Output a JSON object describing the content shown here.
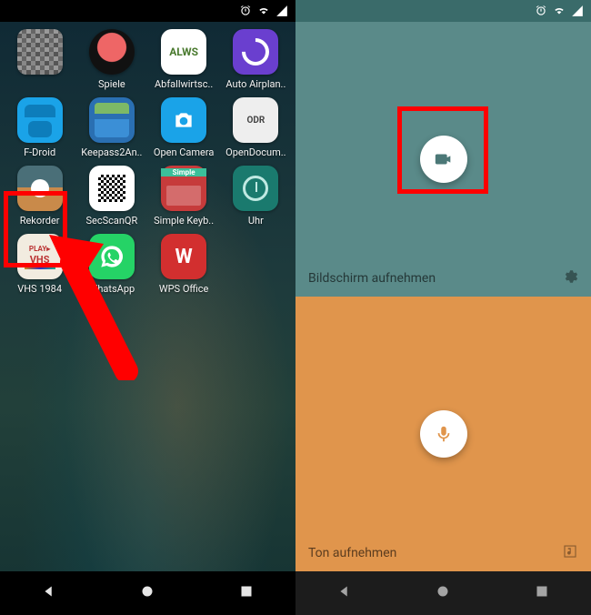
{
  "status": {
    "icons": [
      "alarm",
      "wifi",
      "signal"
    ]
  },
  "drawer": {
    "apps": [
      {
        "id": "pixelated",
        "label": ""
      },
      {
        "id": "spiele",
        "label": "Spiele"
      },
      {
        "id": "alws",
        "label": "Abfallwirtsc..",
        "text": "ALWS"
      },
      {
        "id": "auto",
        "label": "Auto Airplan.."
      },
      {
        "id": "fdroid",
        "label": "F-Droid"
      },
      {
        "id": "keepass",
        "label": "Keepass2An.."
      },
      {
        "id": "opencam",
        "label": "Open Camera"
      },
      {
        "id": "odr",
        "label": "OpenDocum..",
        "text": "ODR"
      },
      {
        "id": "rekorder",
        "label": "Rekorder"
      },
      {
        "id": "secscan",
        "label": "SecScanQR"
      },
      {
        "id": "keyb",
        "label": "Simple Keyb.."
      },
      {
        "id": "uhr",
        "label": "Uhr"
      },
      {
        "id": "vhs",
        "label": "VHS 1984",
        "text": "PLAY▸"
      },
      {
        "id": "whatsapp",
        "label": "WhatsApp"
      },
      {
        "id": "wps",
        "label": "WPS Office",
        "text": "W"
      }
    ]
  },
  "recorder": {
    "screen": {
      "label": "Bildschirm aufnehmen",
      "fab_icon": "videocam",
      "action_icon": "settings"
    },
    "audio": {
      "label": "Ton aufnehmen",
      "fab_icon": "mic",
      "action_icon": "music-note"
    }
  },
  "nav": {
    "buttons": [
      "back",
      "home",
      "recents"
    ]
  },
  "annotation": {
    "highlighted_app": "rekorder",
    "highlighted_fab": "screen"
  }
}
